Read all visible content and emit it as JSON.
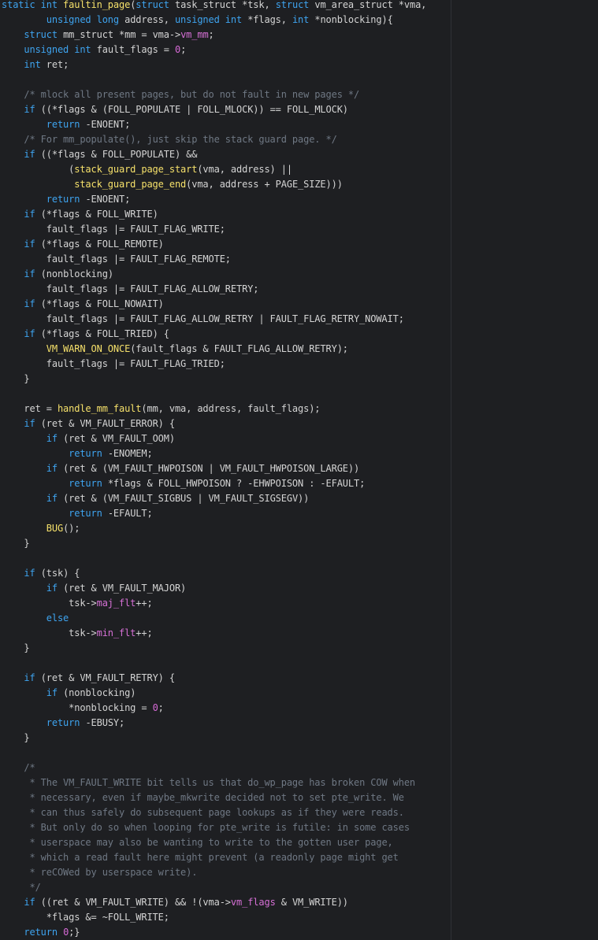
{
  "editor": {
    "background": "#1e1f22",
    "colors": {
      "keyword": "#3ea4f0",
      "function": "#f5e06a",
      "number": "#d66ad6",
      "comment": "#6f7884",
      "field": "#d670d6",
      "text": "#d4d4d4"
    },
    "lines": [
      [
        [
          "kw",
          "static int "
        ],
        [
          "fn",
          "faultin_page"
        ],
        [
          "tx",
          "("
        ],
        [
          "kw",
          "struct "
        ],
        [
          "tx",
          "task_struct *tsk, "
        ],
        [
          "kw",
          "struct "
        ],
        [
          "tx",
          "vm_area_struct *vma,"
        ]
      ],
      [
        [
          "tx",
          "        "
        ],
        [
          "kw",
          "unsigned long "
        ],
        [
          "tx",
          "address, "
        ],
        [
          "kw",
          "unsigned int "
        ],
        [
          "tx",
          "*flags, "
        ],
        [
          "kw",
          "int "
        ],
        [
          "tx",
          "*nonblocking){"
        ]
      ],
      [
        [
          "tx",
          "    "
        ],
        [
          "kw",
          "struct "
        ],
        [
          "tx",
          "mm_struct *mm = vma->"
        ],
        [
          "fld",
          "vm_mm"
        ],
        [
          "tx",
          ";"
        ]
      ],
      [
        [
          "tx",
          "    "
        ],
        [
          "kw",
          "unsigned int "
        ],
        [
          "tx",
          "fault_flags = "
        ],
        [
          "num",
          "0"
        ],
        [
          "tx",
          ";"
        ]
      ],
      [
        [
          "tx",
          "    "
        ],
        [
          "kw",
          "int "
        ],
        [
          "tx",
          "ret;"
        ]
      ],
      [
        [
          "tx",
          ""
        ]
      ],
      [
        [
          "tx",
          "    "
        ],
        [
          "cm",
          "/* mlock all present pages, but do not fault in new pages */"
        ]
      ],
      [
        [
          "tx",
          "    "
        ],
        [
          "kw",
          "if "
        ],
        [
          "tx",
          "((*flags & (FOLL_POPULATE | FOLL_MLOCK)) == FOLL_MLOCK)"
        ]
      ],
      [
        [
          "tx",
          "        "
        ],
        [
          "kw",
          "return "
        ],
        [
          "tx",
          "-ENOENT;"
        ]
      ],
      [
        [
          "tx",
          "    "
        ],
        [
          "cm",
          "/* For mm_populate(), just skip the stack guard page. */"
        ]
      ],
      [
        [
          "tx",
          "    "
        ],
        [
          "kw",
          "if "
        ],
        [
          "tx",
          "((*flags & FOLL_POPULATE) &&"
        ]
      ],
      [
        [
          "tx",
          "            ("
        ],
        [
          "fn",
          "stack_guard_page_start"
        ],
        [
          "tx",
          "(vma, address) ||"
        ]
      ],
      [
        [
          "tx",
          "             "
        ],
        [
          "fn",
          "stack_guard_page_end"
        ],
        [
          "tx",
          "(vma, address + PAGE_SIZE)))"
        ]
      ],
      [
        [
          "tx",
          "        "
        ],
        [
          "kw",
          "return "
        ],
        [
          "tx",
          "-ENOENT;"
        ]
      ],
      [
        [
          "tx",
          "    "
        ],
        [
          "kw",
          "if "
        ],
        [
          "tx",
          "(*flags & FOLL_WRITE)"
        ]
      ],
      [
        [
          "tx",
          "        fault_flags |= FAULT_FLAG_WRITE;"
        ]
      ],
      [
        [
          "tx",
          "    "
        ],
        [
          "kw",
          "if "
        ],
        [
          "tx",
          "(*flags & FOLL_REMOTE)"
        ]
      ],
      [
        [
          "tx",
          "        fault_flags |= FAULT_FLAG_REMOTE;"
        ]
      ],
      [
        [
          "tx",
          "    "
        ],
        [
          "kw",
          "if "
        ],
        [
          "tx",
          "(nonblocking)"
        ]
      ],
      [
        [
          "tx",
          "        fault_flags |= FAULT_FLAG_ALLOW_RETRY;"
        ]
      ],
      [
        [
          "tx",
          "    "
        ],
        [
          "kw",
          "if "
        ],
        [
          "tx",
          "(*flags & FOLL_NOWAIT)"
        ]
      ],
      [
        [
          "tx",
          "        fault_flags |= FAULT_FLAG_ALLOW_RETRY | FAULT_FLAG_RETRY_NOWAIT;"
        ]
      ],
      [
        [
          "tx",
          "    "
        ],
        [
          "kw",
          "if "
        ],
        [
          "tx",
          "(*flags & FOLL_TRIED) {"
        ]
      ],
      [
        [
          "tx",
          "        "
        ],
        [
          "fn",
          "VM_WARN_ON_ONCE"
        ],
        [
          "tx",
          "(fault_flags & FAULT_FLAG_ALLOW_RETRY);"
        ]
      ],
      [
        [
          "tx",
          "        fault_flags |= FAULT_FLAG_TRIED;"
        ]
      ],
      [
        [
          "tx",
          "    }"
        ]
      ],
      [
        [
          "tx",
          ""
        ]
      ],
      [
        [
          "tx",
          "    ret = "
        ],
        [
          "fn",
          "handle_mm_fault"
        ],
        [
          "tx",
          "(mm, vma, address, fault_flags);"
        ]
      ],
      [
        [
          "tx",
          "    "
        ],
        [
          "kw",
          "if "
        ],
        [
          "tx",
          "(ret & VM_FAULT_ERROR) {"
        ]
      ],
      [
        [
          "tx",
          "        "
        ],
        [
          "kw",
          "if "
        ],
        [
          "tx",
          "(ret & VM_FAULT_OOM)"
        ]
      ],
      [
        [
          "tx",
          "            "
        ],
        [
          "kw",
          "return "
        ],
        [
          "tx",
          "-ENOMEM;"
        ]
      ],
      [
        [
          "tx",
          "        "
        ],
        [
          "kw",
          "if "
        ],
        [
          "tx",
          "(ret & (VM_FAULT_HWPOISON | VM_FAULT_HWPOISON_LARGE))"
        ]
      ],
      [
        [
          "tx",
          "            "
        ],
        [
          "kw",
          "return "
        ],
        [
          "tx",
          "*flags & FOLL_HWPOISON ? -EHWPOISON : -EFAULT;"
        ]
      ],
      [
        [
          "tx",
          "        "
        ],
        [
          "kw",
          "if "
        ],
        [
          "tx",
          "(ret & (VM_FAULT_SIGBUS | VM_FAULT_SIGSEGV))"
        ]
      ],
      [
        [
          "tx",
          "            "
        ],
        [
          "kw",
          "return "
        ],
        [
          "tx",
          "-EFAULT;"
        ]
      ],
      [
        [
          "tx",
          "        "
        ],
        [
          "fn",
          "BUG"
        ],
        [
          "tx",
          "();"
        ]
      ],
      [
        [
          "tx",
          "    }"
        ]
      ],
      [
        [
          "tx",
          ""
        ]
      ],
      [
        [
          "tx",
          "    "
        ],
        [
          "kw",
          "if "
        ],
        [
          "tx",
          "(tsk) {"
        ]
      ],
      [
        [
          "tx",
          "        "
        ],
        [
          "kw",
          "if "
        ],
        [
          "tx",
          "(ret & VM_FAULT_MAJOR)"
        ]
      ],
      [
        [
          "tx",
          "            tsk->"
        ],
        [
          "fld",
          "maj_flt"
        ],
        [
          "tx",
          "++;"
        ]
      ],
      [
        [
          "tx",
          "        "
        ],
        [
          "kw",
          "else"
        ]
      ],
      [
        [
          "tx",
          "            tsk->"
        ],
        [
          "fld",
          "min_flt"
        ],
        [
          "tx",
          "++;"
        ]
      ],
      [
        [
          "tx",
          "    }"
        ]
      ],
      [
        [
          "tx",
          ""
        ]
      ],
      [
        [
          "tx",
          "    "
        ],
        [
          "kw",
          "if "
        ],
        [
          "tx",
          "(ret & VM_FAULT_RETRY) {"
        ]
      ],
      [
        [
          "tx",
          "        "
        ],
        [
          "kw",
          "if "
        ],
        [
          "tx",
          "(nonblocking)"
        ]
      ],
      [
        [
          "tx",
          "            *nonblocking = "
        ],
        [
          "num",
          "0"
        ],
        [
          "tx",
          ";"
        ]
      ],
      [
        [
          "tx",
          "        "
        ],
        [
          "kw",
          "return "
        ],
        [
          "tx",
          "-EBUSY;"
        ]
      ],
      [
        [
          "tx",
          "    }"
        ]
      ],
      [
        [
          "tx",
          ""
        ]
      ],
      [
        [
          "tx",
          "    "
        ],
        [
          "cm",
          "/*"
        ]
      ],
      [
        [
          "tx",
          "    "
        ],
        [
          "cm",
          " * The VM_FAULT_WRITE bit tells us that do_wp_page has broken COW when"
        ]
      ],
      [
        [
          "tx",
          "    "
        ],
        [
          "cm",
          " * necessary, even if maybe_mkwrite decided not to set pte_write. We"
        ]
      ],
      [
        [
          "tx",
          "    "
        ],
        [
          "cm",
          " * can thus safely do subsequent page lookups as if they were reads."
        ]
      ],
      [
        [
          "tx",
          "    "
        ],
        [
          "cm",
          " * But only do so when looping for pte_write is futile: in some cases"
        ]
      ],
      [
        [
          "tx",
          "    "
        ],
        [
          "cm",
          " * userspace may also be wanting to write to the gotten user page,"
        ]
      ],
      [
        [
          "tx",
          "    "
        ],
        [
          "cm",
          " * which a read fault here might prevent (a readonly page might get"
        ]
      ],
      [
        [
          "tx",
          "    "
        ],
        [
          "cm",
          " * reCOWed by userspace write)."
        ]
      ],
      [
        [
          "tx",
          "    "
        ],
        [
          "cm",
          " */"
        ]
      ],
      [
        [
          "tx",
          "    "
        ],
        [
          "kw",
          "if "
        ],
        [
          "tx",
          "((ret & VM_FAULT_WRITE) && !(vma->"
        ],
        [
          "fld",
          "vm_flags"
        ],
        [
          "tx",
          " & VM_WRITE))"
        ]
      ],
      [
        [
          "tx",
          "        *flags &= ~FOLL_WRITE;"
        ]
      ],
      [
        [
          "tx",
          "    "
        ],
        [
          "kw",
          "return "
        ],
        [
          "num",
          "0"
        ],
        [
          "tx",
          ";}"
        ]
      ]
    ]
  }
}
